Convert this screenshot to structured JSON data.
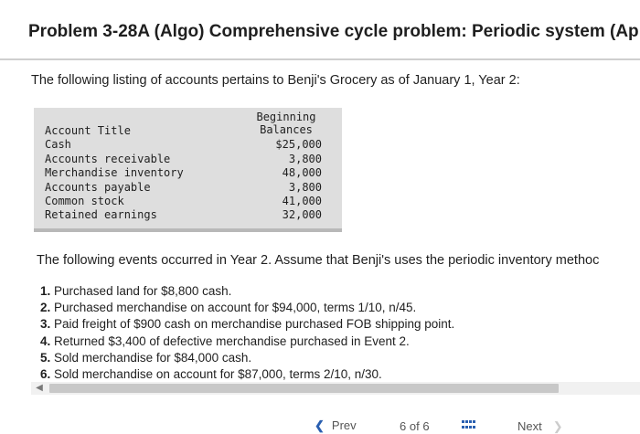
{
  "title": "Problem 3-28A (Algo) Comprehensive cycle problem: Periodic system (Ap",
  "intro": "The following listing of accounts pertains to Benji's Grocery as of January 1, Year 2:",
  "table": {
    "balance_header_line1": "Beginning",
    "balance_header_line2": "Balances",
    "rows": [
      {
        "label": "Account Title",
        "value": ""
      },
      {
        "label": "Cash",
        "value": "$25,000"
      },
      {
        "label": "Accounts receivable",
        "value": "3,800"
      },
      {
        "label": "Merchandise inventory",
        "value": "48,000"
      },
      {
        "label": "Accounts payable",
        "value": "3,800"
      },
      {
        "label": "Common stock",
        "value": "41,000"
      },
      {
        "label": "Retained earnings",
        "value": "32,000"
      }
    ]
  },
  "events_intro": "The following events occurred in Year 2. Assume that Benji's uses the periodic inventory methoc",
  "events": [
    {
      "num": "1.",
      "text": "Purchased land for $8,800 cash."
    },
    {
      "num": "2.",
      "text": "Purchased merchandise on account for $94,000, terms 1/10, n/45."
    },
    {
      "num": "3.",
      "text": "Paid freight of $900 cash on merchandise purchased FOB shipping point."
    },
    {
      "num": "4.",
      "text": "Returned $3,400 of defective merchandise purchased in Event 2."
    },
    {
      "num": "5.",
      "text": "Sold merchandise for $84,000 cash."
    },
    {
      "num": "6.",
      "text": "Sold merchandise on account for $87,000, terms 2/10, n/30."
    }
  ],
  "footer": {
    "prev_label": "Prev",
    "page_current": "6",
    "page_of": "of",
    "page_total": "6",
    "next_label": "Next"
  },
  "colors": {
    "table_background": "#dedede",
    "nav_accent": "#2a5fb0"
  },
  "icons": {
    "prev": "chevron-left-icon",
    "next": "chevron-right-icon",
    "grid": "grid-icon",
    "scroll_left": "scroll-left-arrow-icon"
  }
}
